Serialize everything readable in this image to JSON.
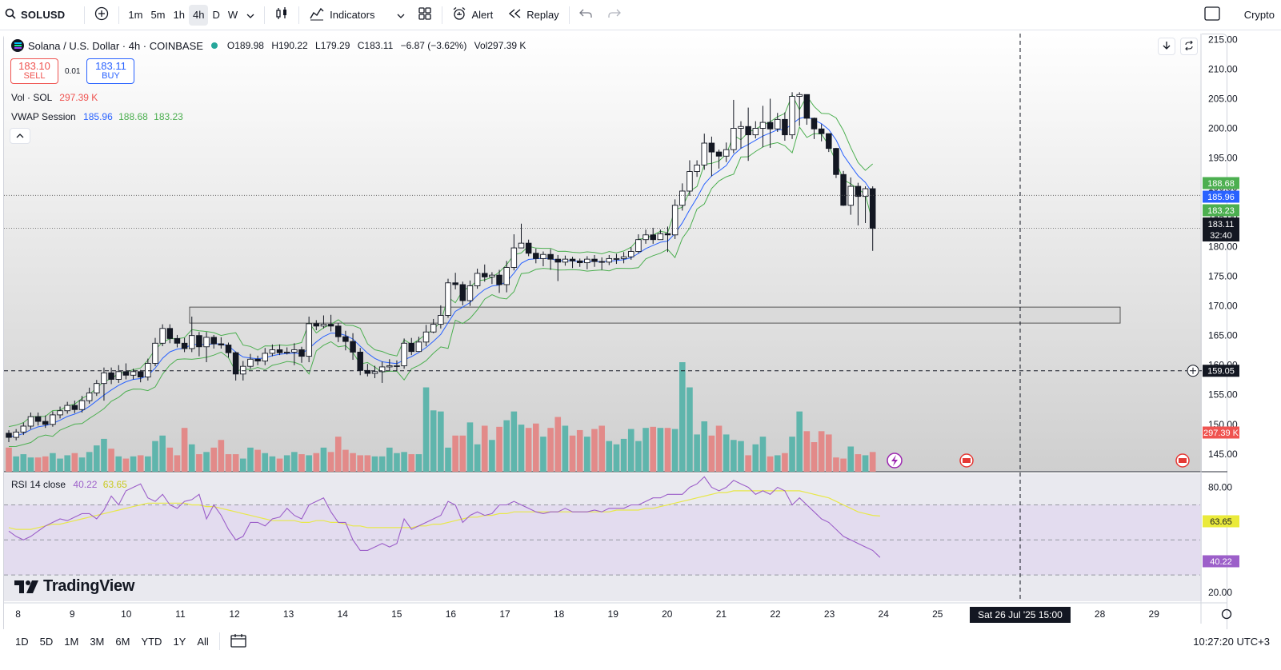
{
  "toolbar": {
    "symbol": "SOLUSD",
    "timeframes": [
      "1m",
      "5m",
      "1h",
      "4h",
      "D",
      "W"
    ],
    "active_timeframe": "4h",
    "indicators_label": "Indicators",
    "alert_label": "Alert",
    "replay_label": "Replay",
    "crypto_label": "Crypto"
  },
  "legend": {
    "title": "Solana / U.S. Dollar · 4h · COINBASE",
    "open": "O189.98",
    "high": "H190.22",
    "low": "L179.29",
    "close": "C183.11",
    "change": "−6.87 (−3.62%)",
    "vol": "Vol297.39 K"
  },
  "trade": {
    "sell_price": "183.10",
    "sell_label": "SELL",
    "spread": "0.01",
    "buy_price": "183.11",
    "buy_label": "BUY"
  },
  "indicators": {
    "volume_name": "Vol · SOL",
    "volume_value": "297.39 K",
    "vwap_name": "VWAP Session",
    "vwap_values": [
      "185.96",
      "188.68",
      "183.23"
    ],
    "rsi_name": "RSI 14 close",
    "rsi_value": "40.22",
    "rsi_ma_value": "63.65"
  },
  "price_tags": {
    "upper_band": "188.68",
    "vwap": "185.96",
    "lower_band": "183.23",
    "last": "183.11",
    "countdown": "32:40",
    "crosshair": "159.05",
    "volume": "297.39 K",
    "rsi_ma": "63.65",
    "rsi": "40.22"
  },
  "crosshair_date": "Sat 26 Jul '25   15:00",
  "range_buttons": [
    "1D",
    "5D",
    "1M",
    "3M",
    "6M",
    "YTD",
    "1Y",
    "All"
  ],
  "clock": "10:27:20 UTC+3",
  "brand": "TradingView",
  "colors": {
    "up": "#ffffff",
    "down": "#131722",
    "vol_up": "#5fb5ac",
    "vol_down": "#e28a89",
    "vwap": "#2962ff",
    "band": "#4caf50",
    "rsi": "#9c5fc9",
    "rsi_ma": "#e8e84a"
  },
  "chart_data": {
    "type": "candlestick",
    "price_axis_ticks": [
      145,
      150,
      155,
      160,
      165,
      170,
      175,
      180,
      185,
      190,
      195,
      200,
      205,
      210,
      215
    ],
    "ylim": [
      142,
      216
    ],
    "rsi_axis_ticks": [
      20,
      80
    ],
    "rsi_ylim": [
      15,
      88
    ],
    "x_tick_labels": [
      "8",
      "9",
      "10",
      "11",
      "12",
      "13",
      "14",
      "15",
      "16",
      "17",
      "18",
      "19",
      "20",
      "21",
      "22",
      "23",
      "24",
      "25",
      "28",
      "29"
    ],
    "zone": {
      "top": 169.8,
      "bottom": 167.1
    },
    "candles": [
      [
        148.5,
        147.8,
        149.0,
        147.0
      ],
      [
        147.8,
        148.7,
        149.2,
        147.3
      ],
      [
        148.7,
        149.7,
        150.3,
        148.2
      ],
      [
        149.7,
        151.3,
        152.0,
        149.2
      ],
      [
        151.3,
        150.5,
        152.0,
        149.8
      ],
      [
        150.5,
        150.0,
        151.5,
        149.4
      ],
      [
        150.0,
        151.6,
        152.2,
        149.6
      ],
      [
        151.6,
        152.3,
        153.0,
        151.0
      ],
      [
        152.3,
        153.2,
        153.8,
        151.8
      ],
      [
        153.2,
        152.5,
        154.0,
        151.9
      ],
      [
        152.5,
        154.0,
        154.8,
        152.0
      ],
      [
        154.0,
        155.3,
        156.2,
        153.5
      ],
      [
        155.3,
        156.9,
        157.5,
        154.8
      ],
      [
        156.9,
        158.7,
        159.6,
        154.0
      ],
      [
        158.7,
        157.6,
        159.6,
        156.8
      ],
      [
        157.6,
        158.9,
        160.0,
        157.0
      ],
      [
        158.9,
        158.3,
        160.3,
        157.6
      ],
      [
        158.3,
        158.9,
        159.4,
        157.6
      ],
      [
        158.9,
        158.0,
        159.2,
        157.1
      ],
      [
        158.0,
        160.3,
        161.1,
        157.4
      ],
      [
        160.3,
        163.7,
        164.6,
        159.8
      ],
      [
        163.7,
        166.2,
        166.9,
        163.2
      ],
      [
        166.2,
        164.5,
        166.9,
        163.7
      ],
      [
        164.5,
        163.7,
        165.1,
        163.0
      ],
      [
        163.7,
        162.8,
        164.6,
        162.2
      ],
      [
        162.8,
        165.0,
        168.2,
        162.2
      ],
      [
        165.0,
        163.1,
        165.6,
        161.5
      ],
      [
        163.1,
        164.7,
        165.6,
        160.5
      ],
      [
        164.7,
        163.6,
        165.1,
        162.8
      ],
      [
        163.6,
        163.4,
        164.7,
        162.8
      ],
      [
        163.4,
        162.1,
        163.8,
        161.3
      ],
      [
        162.1,
        158.5,
        162.3,
        157.4
      ],
      [
        158.5,
        159.8,
        160.7,
        157.4
      ],
      [
        159.8,
        161.0,
        161.9,
        159.4
      ],
      [
        161.0,
        160.7,
        161.6,
        160.0
      ],
      [
        160.7,
        162.0,
        162.9,
        160.0
      ],
      [
        162.0,
        162.6,
        163.5,
        161.5
      ],
      [
        162.6,
        162.1,
        163.5,
        161.7
      ],
      [
        162.1,
        162.2,
        163.0,
        161.8
      ],
      [
        162.2,
        162.6,
        163.7,
        160.0
      ],
      [
        162.6,
        161.5,
        163.1,
        160.4
      ],
      [
        161.5,
        167.0,
        168.2,
        160.5
      ],
      [
        167.0,
        166.6,
        167.6,
        165.9
      ],
      [
        166.6,
        166.9,
        168.4,
        166.2
      ],
      [
        166.9,
        166.6,
        168.5,
        165.7
      ],
      [
        166.6,
        164.8,
        167.1,
        163.9
      ],
      [
        164.8,
        164.0,
        165.8,
        162.5
      ],
      [
        164.0,
        162.2,
        165.4,
        160.9
      ],
      [
        162.2,
        159.1,
        162.9,
        158.3
      ],
      [
        159.1,
        158.6,
        160.2,
        158.1
      ],
      [
        158.6,
        158.9,
        159.9,
        157.8
      ],
      [
        158.9,
        159.7,
        160.6,
        157.0
      ],
      [
        159.7,
        159.9,
        161.0,
        159.0
      ],
      [
        159.9,
        159.9,
        160.8,
        159.0
      ],
      [
        159.9,
        163.7,
        164.5,
        159.4
      ],
      [
        163.7,
        162.3,
        164.6,
        161.7
      ],
      [
        162.3,
        163.9,
        164.8,
        162.9
      ],
      [
        163.9,
        165.6,
        166.8,
        163.2
      ],
      [
        165.6,
        166.9,
        167.8,
        165.4
      ],
      [
        166.9,
        168.4,
        170.1,
        166.2
      ],
      [
        168.4,
        173.9,
        174.6,
        168.0
      ],
      [
        173.9,
        173.6,
        175.6,
        172.8
      ],
      [
        173.6,
        170.9,
        174.1,
        170.1
      ],
      [
        170.9,
        173.4,
        174.3,
        170.0
      ],
      [
        173.4,
        175.5,
        176.3,
        172.9
      ],
      [
        175.5,
        174.9,
        177.0,
        174.1
      ],
      [
        174.9,
        175.2,
        175.7,
        173.7
      ],
      [
        175.2,
        173.6,
        176.1,
        172.2
      ],
      [
        173.6,
        176.5,
        177.6,
        172.3
      ],
      [
        176.5,
        179.8,
        182.1,
        176.0
      ],
      [
        179.8,
        180.6,
        183.9,
        180.0
      ],
      [
        180.6,
        178.9,
        181.2,
        178.4
      ],
      [
        178.9,
        178.0,
        179.7,
        177.2
      ],
      [
        178.0,
        178.7,
        179.2,
        176.7
      ],
      [
        178.7,
        177.9,
        179.6,
        176.1
      ],
      [
        177.9,
        177.4,
        178.6,
        174.2
      ],
      [
        177.4,
        177.9,
        178.5,
        176.8
      ],
      [
        177.9,
        177.6,
        178.3,
        176.4
      ],
      [
        177.6,
        177.3,
        178.0,
        176.6
      ],
      [
        177.3,
        177.9,
        178.4,
        176.2
      ],
      [
        177.9,
        177.5,
        178.6,
        176.6
      ],
      [
        177.5,
        177.4,
        178.2,
        176.1
      ],
      [
        177.4,
        178.0,
        178.6,
        176.9
      ],
      [
        178.0,
        178.0,
        178.8,
        177.1
      ],
      [
        178.0,
        178.3,
        179.1,
        177.2
      ],
      [
        178.3,
        179.2,
        179.9,
        177.8
      ],
      [
        179.2,
        181.2,
        182.1,
        178.9
      ],
      [
        181.2,
        182.0,
        182.9,
        180.5
      ],
      [
        182.0,
        181.2,
        183.2,
        180.5
      ],
      [
        181.2,
        182.2,
        182.9,
        181.2
      ],
      [
        182.2,
        182.0,
        183.4,
        179.1
      ],
      [
        182.0,
        187.0,
        188.0,
        181.3
      ],
      [
        187.0,
        189.4,
        190.7,
        186.1
      ],
      [
        189.4,
        192.7,
        194.6,
        188.6
      ],
      [
        192.7,
        193.8,
        194.6,
        191.8
      ],
      [
        193.8,
        197.5,
        199.1,
        193.0
      ],
      [
        197.5,
        196.0,
        198.6,
        191.9
      ],
      [
        196.0,
        195.3,
        196.4,
        193.2
      ],
      [
        195.3,
        196.4,
        197.6,
        194.3
      ],
      [
        196.4,
        200.0,
        204.8,
        195.8
      ],
      [
        200.0,
        200.3,
        201.2,
        196.6
      ],
      [
        200.3,
        198.9,
        203.5,
        194.5
      ],
      [
        198.9,
        200.0,
        201.2,
        198.3
      ],
      [
        200.0,
        201.0,
        203.8,
        196.8
      ],
      [
        201.0,
        199.9,
        205.0,
        196.7
      ],
      [
        199.9,
        201.5,
        202.6,
        199.4
      ],
      [
        201.5,
        198.9,
        202.7,
        197.9
      ],
      [
        198.9,
        205.4,
        206.1,
        198.2
      ],
      [
        205.4,
        205.7,
        206.1,
        200.4
      ],
      [
        205.7,
        201.7,
        205.7,
        200.6
      ],
      [
        201.7,
        199.9,
        201.8,
        198.2
      ],
      [
        199.9,
        199.1,
        200.7,
        197.8
      ],
      [
        199.1,
        196.6,
        199.1,
        196.0
      ],
      [
        196.6,
        192.2,
        196.7,
        191.6
      ],
      [
        192.2,
        187.0,
        192.8,
        186.9
      ],
      [
        187.0,
        190.2,
        191.7,
        185.4
      ],
      [
        190.2,
        188.5,
        190.8,
        183.6
      ],
      [
        188.5,
        189.8,
        190.2,
        184.0
      ],
      [
        189.8,
        183.1,
        190.2,
        179.3
      ]
    ],
    "volume": [
      22,
      14,
      16,
      13,
      13,
      14,
      17,
      12,
      15,
      17,
      13,
      18,
      24,
      30,
      21,
      14,
      12,
      14,
      15,
      14,
      28,
      33,
      22,
      15,
      40,
      25,
      16,
      18,
      22,
      29,
      16,
      16,
      12,
      22,
      20,
      17,
      14,
      12,
      15,
      18,
      16,
      15,
      17,
      22,
      18,
      32,
      20,
      17,
      15,
      15,
      14,
      14,
      22,
      17,
      18,
      16,
      16,
      77,
      56,
      55,
      22,
      33,
      33,
      45,
      25,
      42,
      29,
      41,
      47,
      55,
      43,
      40,
      44,
      32,
      40,
      50,
      42,
      33,
      38,
      32,
      39,
      42,
      28,
      25,
      30,
      39,
      28,
      40,
      41,
      40,
      40,
      39,
      100,
      77,
      34,
      46,
      33,
      42,
      34,
      29,
      28,
      15,
      25,
      32,
      14,
      15,
      17,
      32,
      55,
      37,
      27,
      37,
      34,
      13,
      12,
      23,
      16,
      15,
      18
    ],
    "rsi": [
      55,
      52,
      50,
      52,
      55,
      58,
      60,
      62,
      61,
      63,
      65,
      65,
      62,
      67,
      75,
      70,
      78,
      80,
      82,
      74,
      72,
      76,
      70,
      68,
      72,
      73,
      76,
      62,
      70,
      64,
      56,
      50,
      52,
      60,
      60,
      58,
      62,
      63,
      68,
      64,
      62,
      70,
      72,
      74,
      66,
      60,
      60,
      50,
      44,
      44,
      46,
      48,
      46,
      48,
      62,
      56,
      58,
      60,
      62,
      64,
      72,
      70,
      60,
      64,
      66,
      64,
      65,
      70,
      70,
      72,
      70,
      68,
      66,
      65,
      66,
      66,
      68,
      66,
      66,
      66,
      67,
      66,
      68,
      68,
      68,
      70,
      70,
      72,
      74,
      74,
      76,
      76,
      76,
      80,
      82,
      86,
      80,
      78,
      80,
      84,
      82,
      80,
      76,
      78,
      76,
      80,
      78,
      70,
      74,
      70,
      66,
      62,
      60,
      56,
      52,
      50,
      48,
      46,
      44,
      40
    ],
    "rsi_ma": [
      57,
      56,
      56,
      56,
      57,
      58,
      59,
      59,
      60,
      61,
      62,
      63,
      64,
      65,
      66,
      67,
      68,
      69,
      70,
      71,
      71,
      71,
      71,
      71,
      71,
      70,
      70,
      69,
      69,
      68,
      67,
      66,
      65,
      64,
      63,
      62,
      61,
      61,
      61,
      61,
      60,
      60,
      61,
      61,
      60,
      60,
      59,
      58,
      58,
      57,
      57,
      57,
      57,
      57,
      57,
      57,
      58,
      58,
      59,
      59,
      60,
      61,
      62,
      63,
      63,
      64,
      64,
      65,
      65,
      66,
      66,
      66,
      66,
      66,
      66,
      66,
      66,
      66,
      66,
      66,
      66,
      66,
      66,
      67,
      67,
      67,
      67,
      68,
      68,
      69,
      70,
      71,
      72,
      73,
      74,
      75,
      76,
      77,
      77,
      78,
      78,
      78,
      78,
      78,
      78,
      78,
      78,
      78,
      78,
      77,
      76,
      75,
      74,
      72,
      70,
      68,
      66,
      65,
      64,
      63.65
    ]
  }
}
